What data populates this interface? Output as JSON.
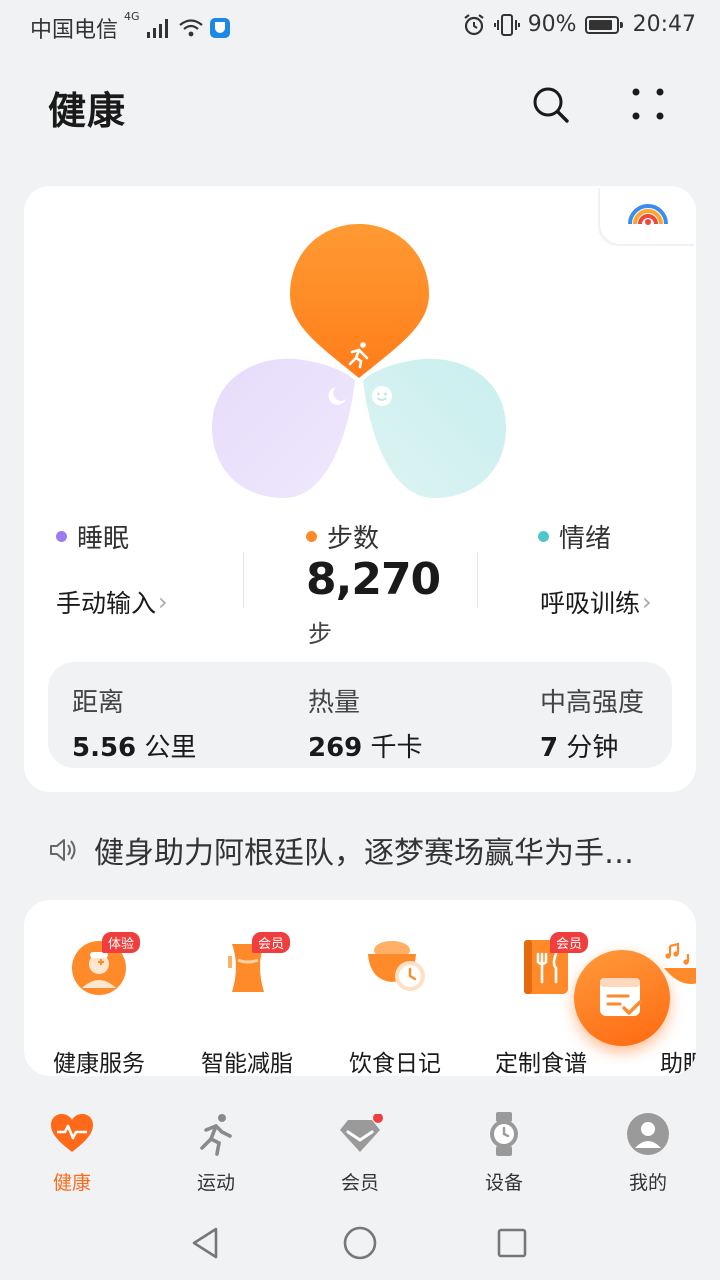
{
  "status_bar": {
    "carrier": "中国电信",
    "network": "4G",
    "battery_percent": "90%",
    "time": "20:47",
    "battery_level": 0.9
  },
  "header": {
    "title": "健康",
    "icons": [
      "search-icon",
      "more-icon"
    ]
  },
  "activity_card": {
    "sleep": {
      "label": "睡眠",
      "link": "手动输入",
      "color": "#9b7cf0"
    },
    "steps": {
      "label": "步数",
      "value": "8,270",
      "unit": "步",
      "color": "#ff8a2a"
    },
    "mood": {
      "label": "情绪",
      "link": "呼吸训练",
      "color": "#4ec6cc"
    },
    "stats": [
      {
        "label": "距离",
        "value": "5.56",
        "unit": "公里"
      },
      {
        "label": "热量",
        "value": "269",
        "unit": "千卡"
      },
      {
        "label": "中高强度",
        "value": "7",
        "unit": "分钟"
      }
    ]
  },
  "announcement": {
    "text": "健身助力阿根廷队，逐梦赛场赢华为手…"
  },
  "services": [
    {
      "label": "健康服务",
      "badge": "体验"
    },
    {
      "label": "智能减脂",
      "badge": "会员"
    },
    {
      "label": "饮食日记",
      "badge": ""
    },
    {
      "label": "定制食谱",
      "badge": "会员"
    },
    {
      "label": "助眠",
      "badge": ""
    }
  ],
  "bottom_nav": [
    {
      "label": "健康",
      "active": true
    },
    {
      "label": "运动",
      "active": false
    },
    {
      "label": "会员",
      "active": false
    },
    {
      "label": "设备",
      "active": false
    },
    {
      "label": "我的",
      "active": false
    }
  ],
  "colors": {
    "accent": "#ff6a1a",
    "background": "#f1f2f4"
  }
}
